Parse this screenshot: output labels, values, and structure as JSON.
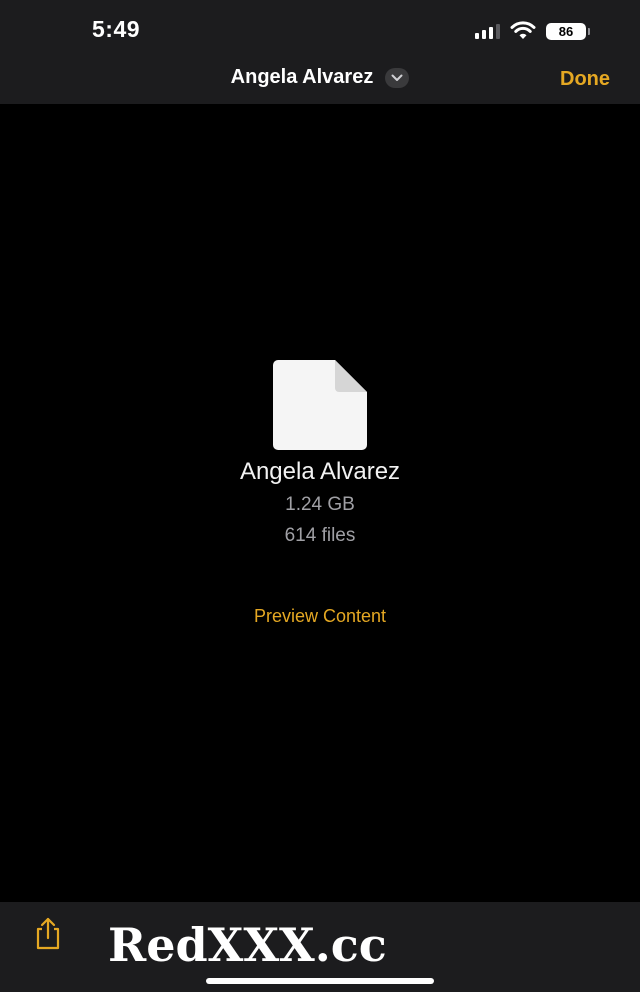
{
  "status_bar": {
    "time": "5:49",
    "battery": "86",
    "icons": [
      "signal-icon",
      "wifi-icon",
      "battery-icon"
    ]
  },
  "nav": {
    "title": "Angela Alvarez",
    "done_label": "Done",
    "icons": [
      "chevron-down-icon"
    ]
  },
  "file": {
    "icon": "document-icon",
    "name": "Angela Alvarez",
    "size": "1.24 GB",
    "count": "614 files"
  },
  "actions": {
    "preview_label": "Preview Content"
  },
  "toolbar": {
    "share_icon": "share-icon"
  },
  "watermark": "RedXXX.cc",
  "colors": {
    "accent": "#e5a823",
    "bar_background": "#1c1c1e",
    "background": "#000000",
    "secondary_text": "#a0a0a5"
  }
}
